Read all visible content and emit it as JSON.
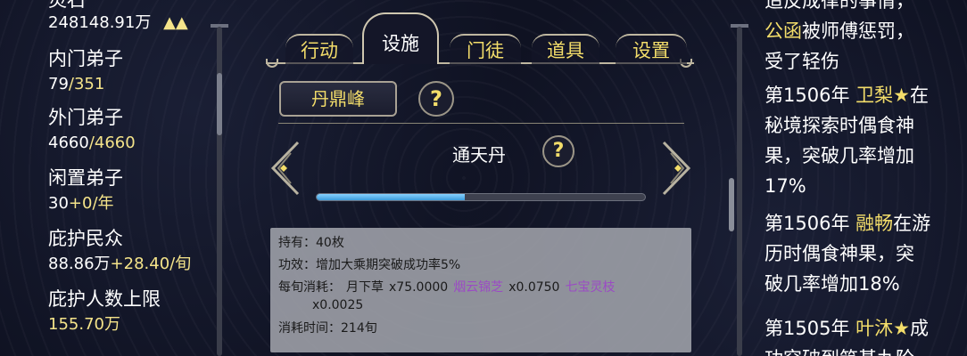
{
  "left": {
    "top_label_partial": "灵石",
    "top_value": "248148.91万",
    "top_icons": "▲▲",
    "stats": [
      {
        "label": "内门弟子",
        "value_a": "79",
        "value_b": "/351"
      },
      {
        "label": "外门弟子",
        "value_a": "4660",
        "value_b": "/4660"
      },
      {
        "label": "闲置弟子",
        "value_a": "30",
        "value_b": "+0/年"
      },
      {
        "label": "庇护民众",
        "value_a": "88.86万",
        "value_b": "+28.40/旬"
      },
      {
        "label": "庇护人数上限",
        "value_a": "155.70万",
        "value_b": ""
      }
    ]
  },
  "tabs": [
    {
      "label": "行动",
      "active": false
    },
    {
      "label": "设施",
      "active": true
    },
    {
      "label": "门徒",
      "active": false
    },
    {
      "label": "道具",
      "active": false
    },
    {
      "label": "设置",
      "active": false
    }
  ],
  "facility": {
    "peak_button": "丹鼎峰",
    "help_icon": "?",
    "pill_name": "通天丹",
    "progress": 0.45
  },
  "info": {
    "hold": "持有：40枚",
    "effect": "功效：增加大乘期突破成功率5%",
    "consume_label": "每旬消耗：",
    "materials": [
      {
        "name": "月下草",
        "qty": "x75.0000",
        "color": "#1a1a1a"
      },
      {
        "name": "烟云锦芝",
        "qty": "x0.0750",
        "color": "#9b4bc4"
      },
      {
        "name": "七宝灵枝",
        "qty": "",
        "color": "#9b4bc4"
      }
    ],
    "last_qty": "x0.0025",
    "time": "消耗时间：214旬"
  },
  "log": {
    "line0_partial": "造反成律的事情，",
    "line1_name": "公函",
    "line1_rest": "被师傅惩罚，",
    "line2": "受了轻伤",
    "entry1": {
      "year": "第1506年",
      "name": "卫梨",
      "star": "★",
      "tail": "在",
      "l2": "秘境探索时偶食神",
      "l3": "果，突破几率增加",
      "l4": "17%"
    },
    "entry2": {
      "year": "第1506年",
      "name": "融畅",
      "tail": "在游",
      "l2": "历时偶食神果，突",
      "l3": "破几率增加18%"
    },
    "entry3": {
      "year": "第1505年",
      "name": "叶沐",
      "star": "★",
      "tail": "成",
      "l2": "功突破到筑基九阶"
    }
  }
}
